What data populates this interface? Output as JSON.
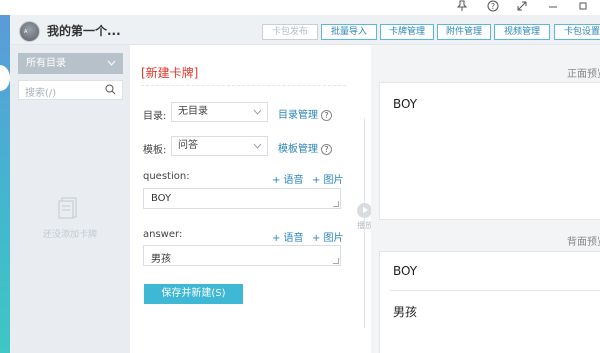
{
  "window": {
    "pin_icon": "pin-icon",
    "help_icon": "help-circle-icon",
    "expand_icon": "expand-icon",
    "minimize_icon": "minimize-icon",
    "maximize_icon": "maximize-icon"
  },
  "header": {
    "avatar_tag": "A",
    "deck_title": "我的第一个...",
    "buttons": [
      {
        "label": "卡包发布",
        "enabled": false
      },
      {
        "label": "批量导入",
        "enabled": true
      },
      {
        "label": "卡牌管理",
        "enabled": true
      },
      {
        "label": "附件管理",
        "enabled": true
      },
      {
        "label": "视频管理",
        "enabled": true
      },
      {
        "label": "卡包设置",
        "enabled": true
      }
    ]
  },
  "sidebar": {
    "directory_select": "所有目录",
    "search_placeholder": "搜索(/)",
    "empty_text": "还没添加卡牌"
  },
  "editor": {
    "title": "[新建卡牌]",
    "directory_label": "目录:",
    "directory_value": "无目录",
    "directory_manage": "目录管理",
    "template_label": "模板:",
    "template_value": "问答",
    "template_manage": "模板管理",
    "help_glyph": "?",
    "fields": [
      {
        "name": "question:",
        "value": "BOY",
        "add_audio": "+ 语音",
        "add_image": "+ 图片"
      },
      {
        "name": "answer:",
        "value": "男孩",
        "add_audio": "+ 语音",
        "add_image": "+ 图片"
      }
    ],
    "save_button": "保存并新建(S)"
  },
  "playback": {
    "label": "播放"
  },
  "preview": {
    "front_label": "正面预览",
    "front_text": "BOY",
    "back_label": "背面预览",
    "back_front_text": "BOY",
    "back_answer_text": "男孩"
  },
  "colors": {
    "accent": "#3eb8d4",
    "link": "#2a86b8",
    "title_red": "#e2372b",
    "sidebar_bg": "#e9edf1",
    "header_bg": "#eef1f4"
  }
}
